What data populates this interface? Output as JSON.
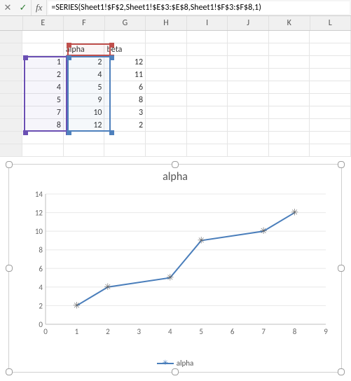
{
  "formula_bar": {
    "fx_label": "fx",
    "value": "=SERIES(Sheet1!$F$2,Sheet1!$E$3:$E$8,Sheet1!$F$3:$F$8,1)"
  },
  "columns": [
    "E",
    "F",
    "G",
    "H",
    "I",
    "J",
    "K",
    "L"
  ],
  "grid": {
    "headers": {
      "F": "alpha",
      "G": "beta"
    },
    "rows": [
      {
        "E": "1",
        "F": "2",
        "G": "12"
      },
      {
        "E": "2",
        "F": "4",
        "G": "11"
      },
      {
        "E": "4",
        "F": "5",
        "G": "6"
      },
      {
        "E": "5",
        "F": "9",
        "G": "8"
      },
      {
        "E": "7",
        "F": "10",
        "G": "3"
      },
      {
        "E": "8",
        "F": "12",
        "G": "2"
      }
    ]
  },
  "highlights": {
    "E_range": "E3:E8",
    "F2_cell": "F2",
    "F_range": "F3:F8",
    "E_color": "#6a4fb3",
    "F2_color": "#c0504d",
    "F_color": "#4f81bd"
  },
  "chart_data": {
    "type": "line",
    "title": "alpha",
    "series": [
      {
        "name": "alpha",
        "x": [
          1,
          2,
          4,
          5,
          7,
          8
        ],
        "y": [
          2,
          4,
          5,
          9,
          10,
          12
        ]
      }
    ],
    "xlim": [
      0,
      9
    ],
    "ylim": [
      0,
      14
    ],
    "xticks": [
      0,
      1,
      2,
      3,
      4,
      5,
      6,
      7,
      8,
      9
    ],
    "yticks": [
      0,
      2,
      4,
      6,
      8,
      10,
      12,
      14
    ],
    "legend_label": "alpha"
  }
}
